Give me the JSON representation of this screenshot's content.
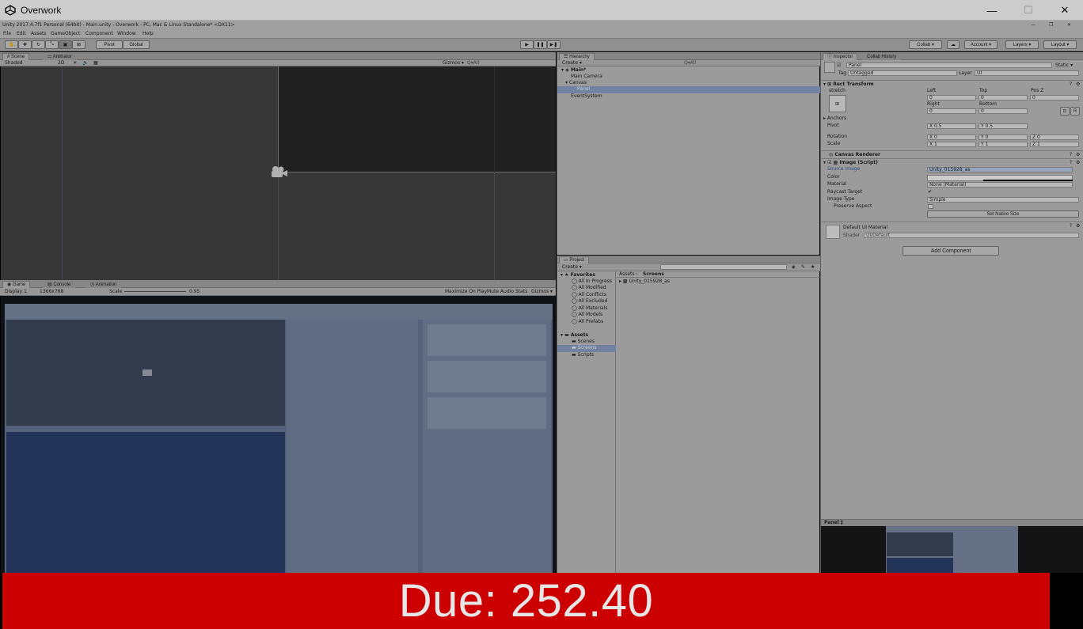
{
  "window": {
    "title": "Overwork",
    "min_glyph": "—",
    "max_glyph": "☐",
    "close_glyph": "✕"
  },
  "unity_title": "Unity 2017.4.7f1 Personal (64bit) - Main.unity - Overwork - PC, Mac & Linux Standalone* <DX11>",
  "unity_title_controls": [
    "—",
    "❐",
    "✕"
  ],
  "menu": [
    "File",
    "Edit",
    "Assets",
    "GameObject",
    "Component",
    "Window",
    "Help"
  ],
  "toolbar": {
    "pivot": "Pivot",
    "global": "Global",
    "collab": "Collab ▾",
    "account": "Account ▾",
    "layers": "Layers ▾",
    "layout": "Layout ▾"
  },
  "scene": {
    "tab_scene": "Scene",
    "tab_animator": "Animator",
    "shading": "Shaded",
    "mode_2d": "2D",
    "gizmos": "Gizmos ▾",
    "search_placeholder": "Q▾All"
  },
  "game": {
    "tab_game": "Game",
    "tab_console": "Console",
    "tab_animation": "Animation",
    "display": "Display 1",
    "resolution": "1366x768",
    "scale_label": "Scale",
    "scale_value": "0.95",
    "maximize": "Maximize On Play",
    "mute": "Mute Audio",
    "stats": "Stats",
    "gizmos": "Gizmos ▾"
  },
  "hierarchy": {
    "tab": "Hierarchy",
    "create": "Create ▾",
    "search_placeholder": "Q▾All",
    "items": [
      {
        "label": "Main*",
        "depth": 0,
        "bold": true,
        "selected": false
      },
      {
        "label": "Main Camera",
        "depth": 1,
        "bold": false,
        "selected": false
      },
      {
        "label": "Canvas",
        "depth": 1,
        "bold": false,
        "selected": false
      },
      {
        "label": "Panel",
        "depth": 2,
        "bold": false,
        "selected": true
      },
      {
        "label": "EventSystem",
        "depth": 1,
        "bold": false,
        "selected": false
      }
    ]
  },
  "project": {
    "tab": "Project",
    "create": "Create ▾",
    "breadcrumb_root": "Assets",
    "breadcrumb_sep": "›",
    "breadcrumb_leaf": "Screens",
    "favorites_label": "Favorites",
    "favorites": [
      "All In Progress",
      "All Modified",
      "All Conflicts",
      "All Excluded",
      "All Materials",
      "All Models",
      "All Prefabs"
    ],
    "assets_label": "Assets",
    "folders": [
      "Scenes",
      "Screens",
      "Scripts"
    ],
    "selected_folder": "Screens",
    "file": "Unity_015928_as"
  },
  "inspector": {
    "tab_inspector": "Inspector",
    "tab_collab": "Collab History",
    "object_name": "Panel",
    "static_label": "Static ▾",
    "tag_label": "Tag",
    "tag_value": "Untagged",
    "layer_label": "Layer",
    "layer_value": "UI",
    "rect_transform": "Rect Transform",
    "stretch": "stretch",
    "left_label": "Left",
    "left_value": "0",
    "top_label": "Top",
    "top_value": "0",
    "posz_label": "Pos Z",
    "posz_value": "0",
    "right_label": "Right",
    "right_value": "0",
    "bottom_label": "Bottom",
    "bottom_value": "0",
    "btn_blueprint": "⊡",
    "btn_raw": "R",
    "anchors": "Anchors",
    "pivot": "Pivot",
    "pivot_x": "X 0.5",
    "pivot_y": "Y 0.5",
    "rotation": "Rotation",
    "rot_x": "X 0",
    "rot_y": "Y 0",
    "rot_z": "Z 0",
    "scale": "Scale",
    "scale_x": "X 1",
    "scale_y": "Y 1",
    "scale_z": "Z 1",
    "canvas_renderer": "Canvas Renderer",
    "image_script": "Image (Script)",
    "source_image_label": "Source Image",
    "source_image_value": "Unity_015928_as",
    "color_label": "Color",
    "material_label": "Material",
    "material_value": "None (Material)",
    "raycast_label": "Raycast Target",
    "raycast_check": "✔",
    "image_type_label": "Image Type",
    "image_type_value": "Simple",
    "preserve_label": "Preserve Aspect",
    "set_native": "Set Native Size",
    "default_material": "Default UI Material",
    "shader_label": "Shader",
    "shader_value": "UI/Default",
    "add_component": "Add Component",
    "preview_label": "Panel ‡"
  },
  "due": {
    "label": "Due: 252.40"
  }
}
